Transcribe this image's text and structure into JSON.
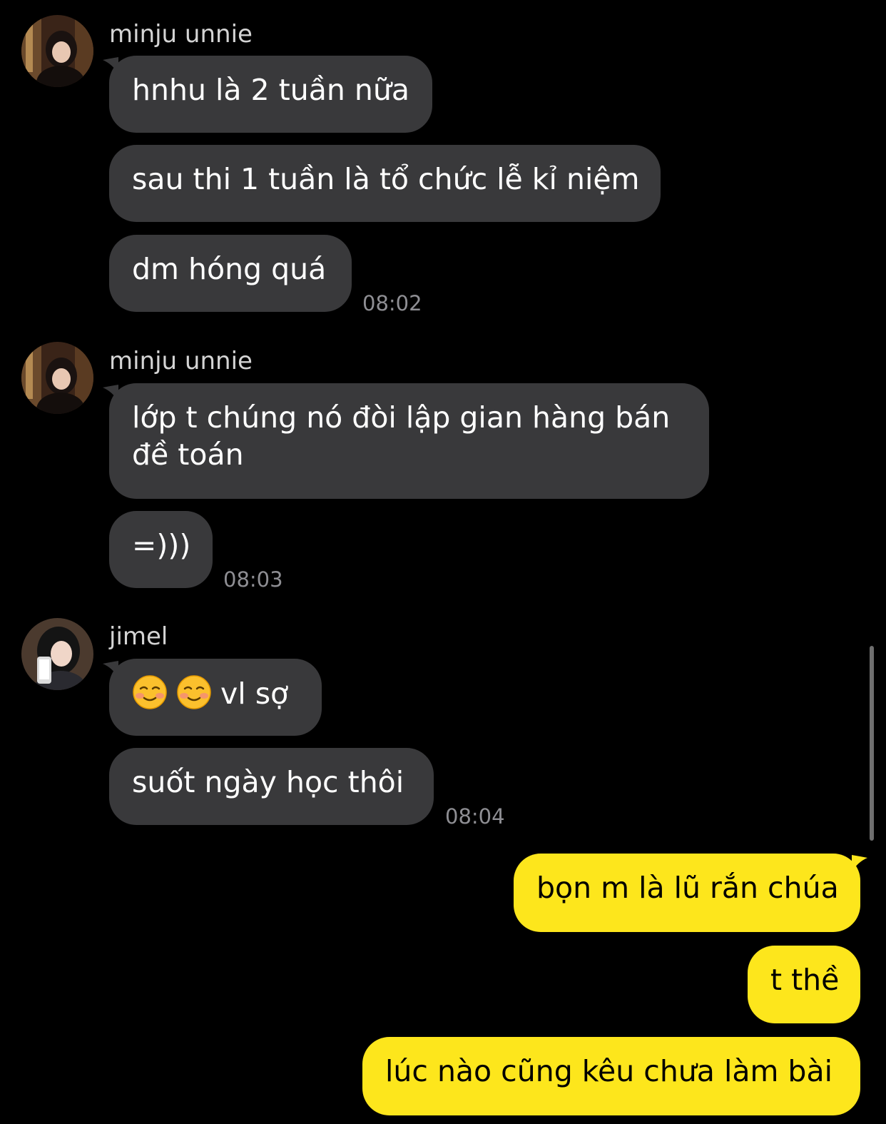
{
  "groups": [
    {
      "sender": "minju unnie",
      "avatar_icon": "profile-photo-icon",
      "messages": [
        "hnhu là 2 tuần nữa",
        "sau thi 1 tuần là tổ chức lễ kỉ niệm",
        "dm hóng quá"
      ],
      "time": "08:02"
    },
    {
      "sender": "minju unnie",
      "avatar_icon": "profile-photo-icon",
      "messages": [
        "lớp t chúng nó đòi lập gian hàng bán đề toán",
        "=)))"
      ],
      "time": "08:03"
    },
    {
      "sender": "jimel",
      "avatar_icon": "profile-photo-icon",
      "messages": [
        "vl sợ",
        "suốt ngày học thôi"
      ],
      "emoji": "smiling-face-icon",
      "time": "08:04"
    }
  ],
  "outgoing": [
    "bọn m là lũ rắn chúa",
    "t thề",
    "lúc nào cũng kêu chưa làm bài"
  ],
  "colors": {
    "background": "#000000",
    "incoming_bubble": "#39393b",
    "outgoing_bubble": "#fde61c",
    "timestamp": "#8e8e93"
  }
}
